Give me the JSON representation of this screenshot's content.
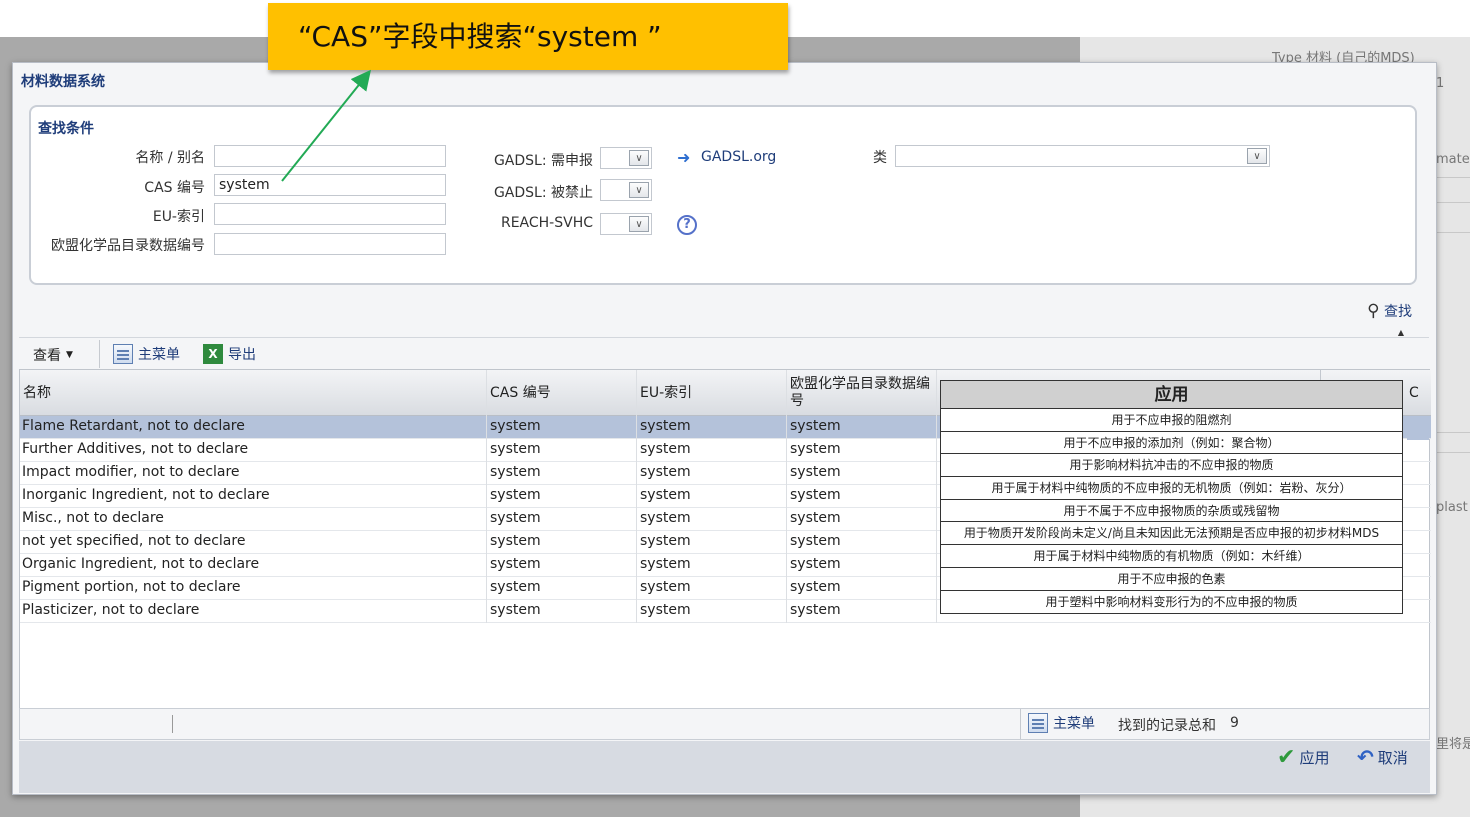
{
  "background": {
    "texts": [
      "Type  材料 (自己的MDS)",
      "1",
      "mater",
      "plast",
      "里将是"
    ]
  },
  "dialog": {
    "title": "材料数据系统",
    "criteria": {
      "title": "查找条件",
      "name_label": "名称 / 别名",
      "name_value": "",
      "cas_label": "CAS 编号",
      "cas_value": "system",
      "eu_label": "EU-索引",
      "eu_value": "",
      "ec_label": "欧盟化学品目录数据编号",
      "ec_value": "",
      "gadsl_declare_label": "GADSL: 需申报",
      "gadsl_prohibited_label": "GADSL: 被禁止",
      "reach_label": "REACH-SVHC",
      "gadsl_link": "GADSL.org",
      "class_label": "类",
      "help_symbol": "?"
    },
    "search_button": "查找",
    "toolbar": {
      "view": "查看",
      "main_menu": "主菜单",
      "export": "导出"
    },
    "table": {
      "columns": [
        "名称",
        "CAS 编号",
        "EU-索引",
        "欧盟化学品目录数据编号",
        "C"
      ],
      "rows": [
        {
          "name": "Flame Retardant, not to declare",
          "cas": "system",
          "eu": "system",
          "ec": "system"
        },
        {
          "name": "Further Additives, not to declare",
          "cas": "system",
          "eu": "system",
          "ec": "system"
        },
        {
          "name": "Impact modifier, not to declare",
          "cas": "system",
          "eu": "system",
          "ec": "system"
        },
        {
          "name": "Inorganic Ingredient, not to declare",
          "cas": "system",
          "eu": "system",
          "ec": "system"
        },
        {
          "name": "Misc., not to declare",
          "cas": "system",
          "eu": "system",
          "ec": "system"
        },
        {
          "name": "not yet specified, not to declare",
          "cas": "system",
          "eu": "system",
          "ec": "system"
        },
        {
          "name": "Organic Ingredient, not to declare",
          "cas": "system",
          "eu": "system",
          "ec": "system"
        },
        {
          "name": "Pigment portion, not to declare",
          "cas": "system",
          "eu": "system",
          "ec": "system"
        },
        {
          "name": "Plasticizer, not to declare",
          "cas": "system",
          "eu": "system",
          "ec": "system"
        }
      ]
    },
    "status": {
      "main_menu": "主菜单",
      "total_label": "找到的记录总和",
      "total_count": "9"
    },
    "footer": {
      "apply": "应用",
      "cancel": "取消"
    }
  },
  "application_popup": {
    "title": "应用",
    "rows": [
      "用于不应申报的阻燃剂",
      "用于不应申报的添加剂（例如：聚合物）",
      "用于影响材料抗冲击的不应申报的物质",
      "用于属于材料中纯物质的不应申报的无机物质（例如：岩粉、灰分）",
      "用于不属于不应申报物质的杂质或残留物",
      "用于物质开发阶段尚未定义/尚且未知因此无法预期是否应申报的初步材料MDS",
      "用于属于材料中纯物质的有机物质（例如：木纤维）",
      "用于不应申报的色素",
      "用于塑料中影响材料变形行为的不应申报的物质"
    ]
  },
  "callout": {
    "text": "“CAS”字段中搜索“system ”"
  },
  "colors": {
    "callout_bg": "#ffc000",
    "arrow": "#22aa55",
    "selected_row": "#b4c2da",
    "link_blue": "#1f3d7a"
  }
}
